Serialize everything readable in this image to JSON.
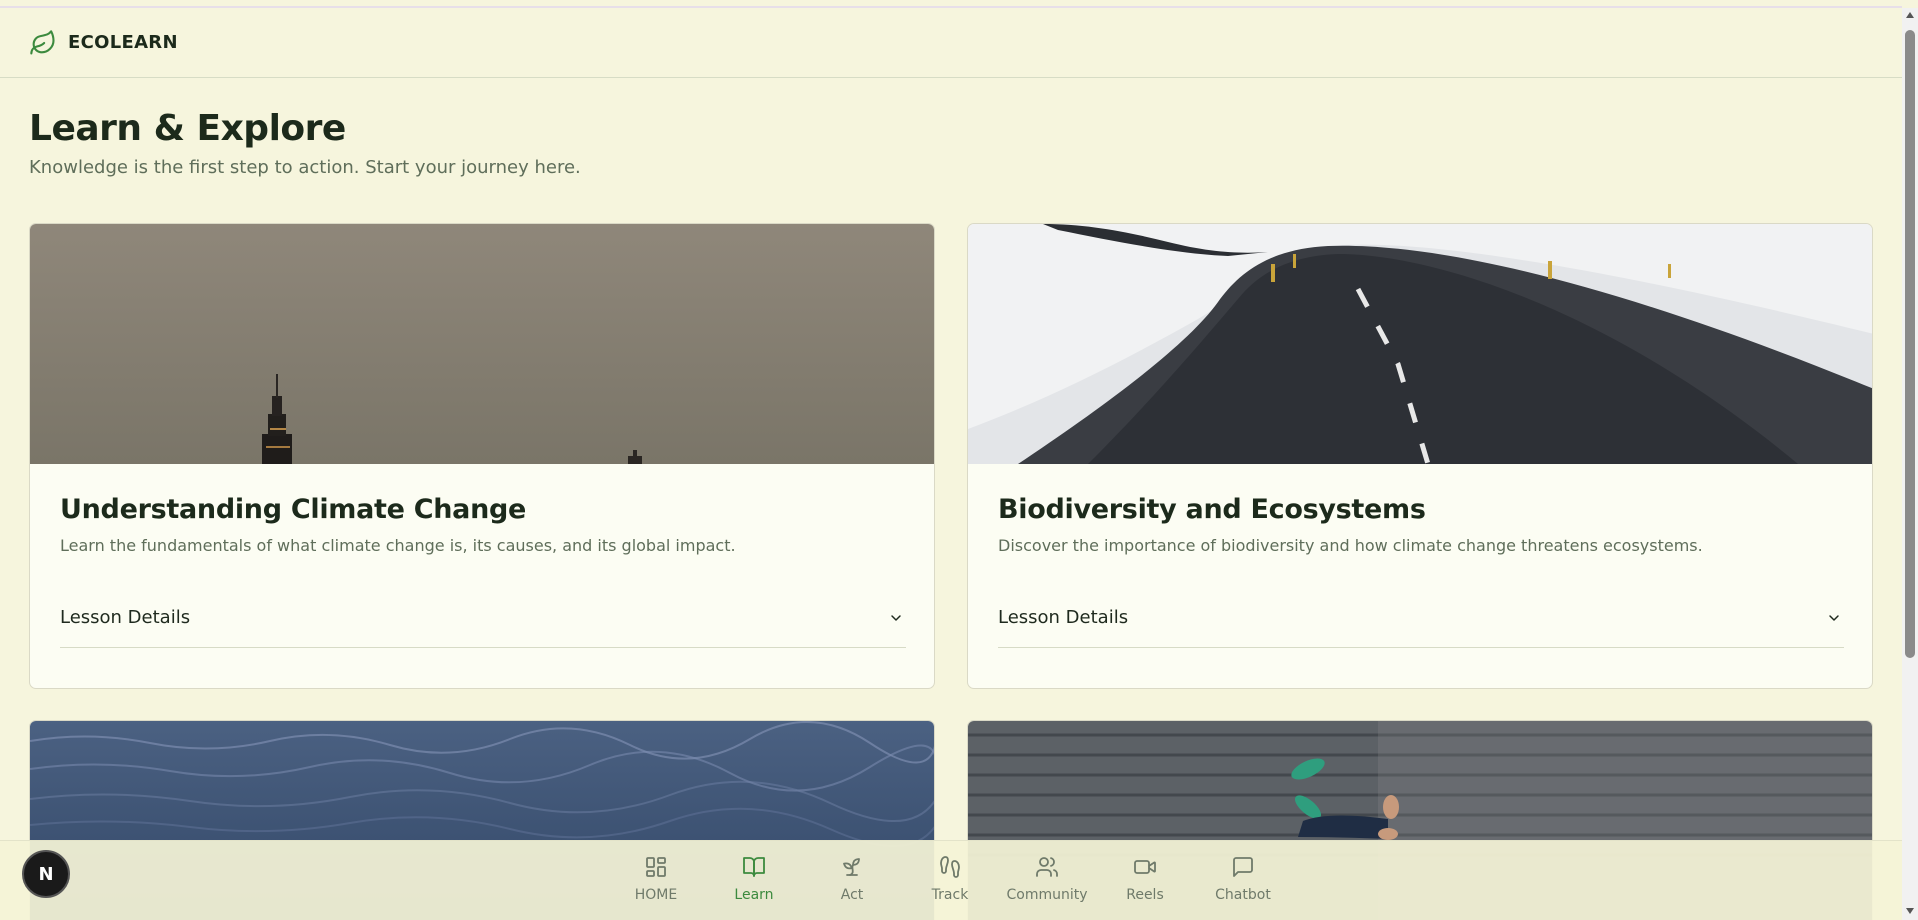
{
  "brand": {
    "name": "ECOLEARN",
    "icon": "leaf-icon"
  },
  "page": {
    "title": "Learn & Explore",
    "subtitle": "Knowledge is the first step to action. Start your journey here."
  },
  "lessons": [
    {
      "title": "Understanding Climate Change",
      "description": "Learn the fundamentals of what climate change is, its causes, and its global impact.",
      "details_label": "Lesson Details",
      "image": "smoggy-city-skyline"
    },
    {
      "title": "Biodiversity and Ecosystems",
      "description": "Discover the importance of biodiversity and how climate change threatens ecosystems.",
      "details_label": "Lesson Details",
      "image": "snowy-road"
    },
    {
      "image": "ocean-waves"
    },
    {
      "image": "wooden-boardwalk-with-person"
    }
  ],
  "nav": {
    "items": [
      {
        "label": "HOME",
        "icon": "grid-icon",
        "active": false
      },
      {
        "label": "Learn",
        "icon": "book-icon",
        "active": true
      },
      {
        "label": "Act",
        "icon": "sprout-icon",
        "active": false
      },
      {
        "label": "Track",
        "icon": "footprints-icon",
        "active": false
      },
      {
        "label": "Community",
        "icon": "users-icon",
        "active": false
      },
      {
        "label": "Reels",
        "icon": "video-icon",
        "active": false
      },
      {
        "label": "Chatbot",
        "icon": "message-icon",
        "active": false
      }
    ]
  },
  "badge": {
    "letter": "N"
  },
  "colors": {
    "background": "#f6f5dd",
    "accent": "#3c8a3e",
    "text": "#1c2a1b",
    "muted": "#5f6e5a"
  }
}
